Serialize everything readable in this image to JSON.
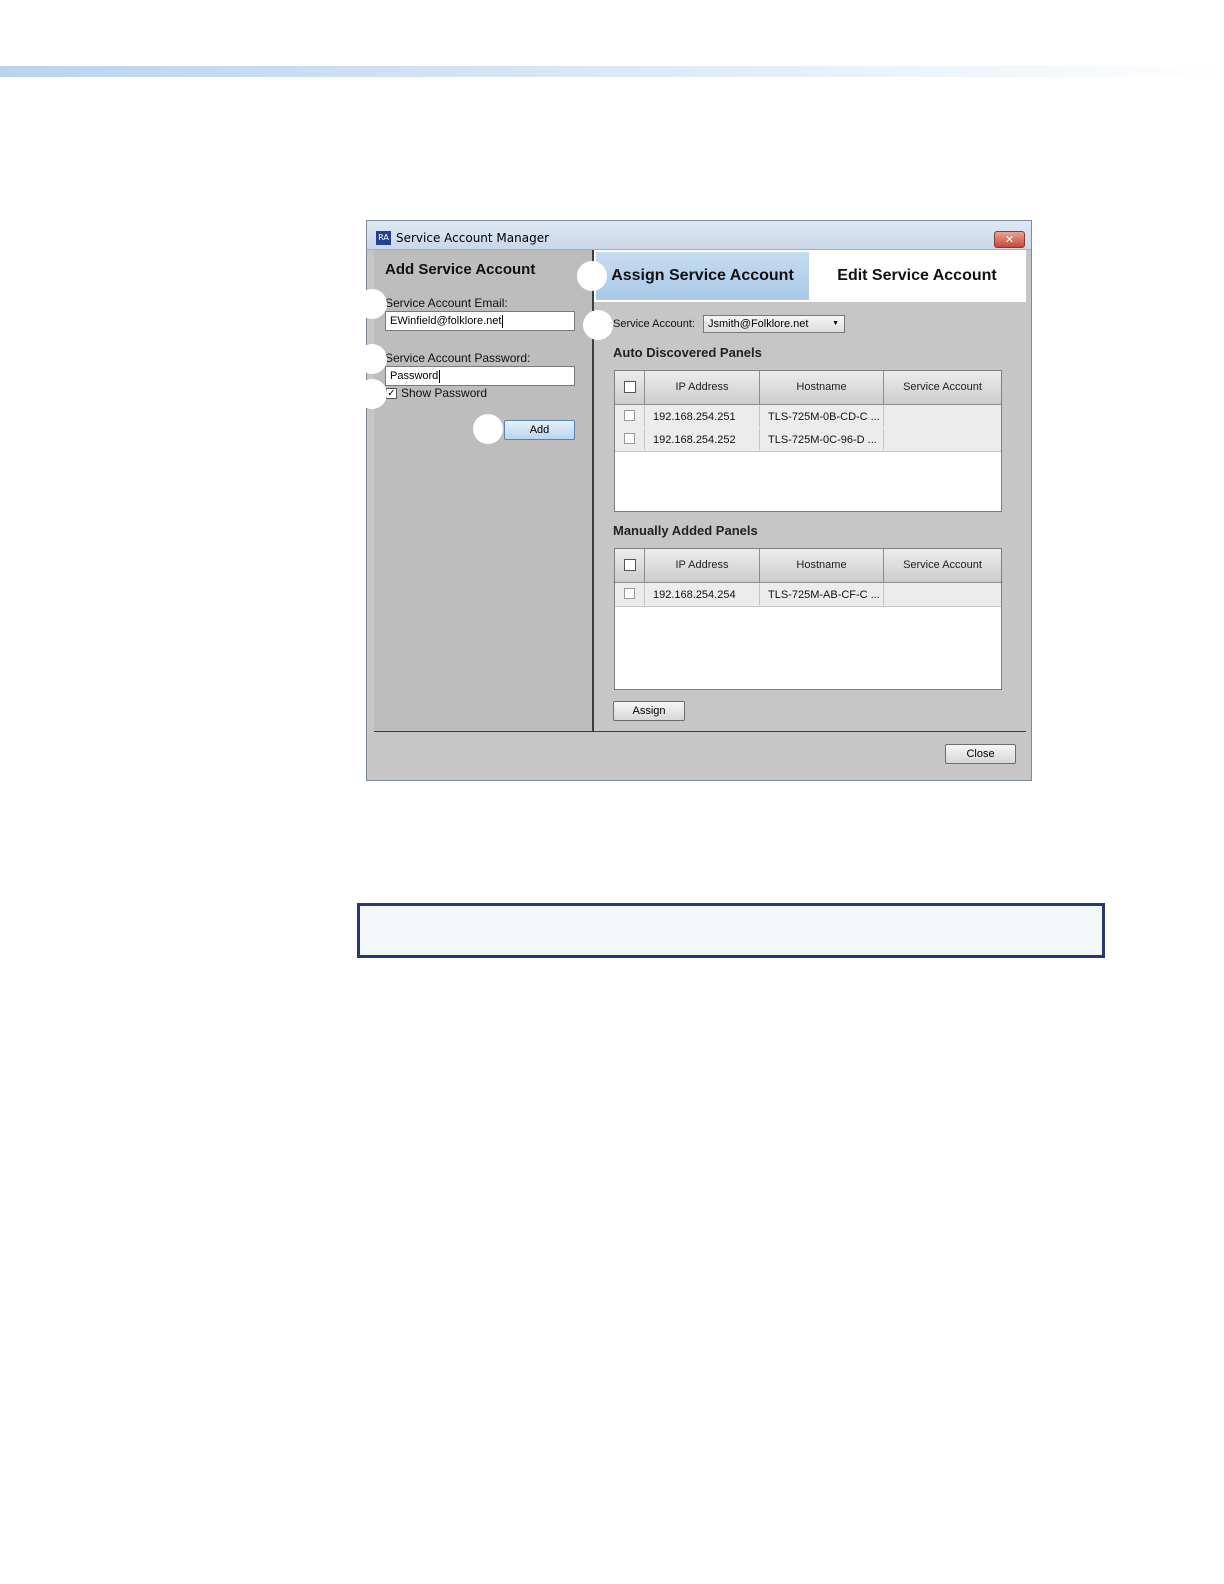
{
  "window": {
    "title": "Service Account Manager",
    "icon_text": "RA",
    "close_symbol": "✕"
  },
  "left": {
    "heading": "Add Service Account",
    "email_label": "Service Account Email:",
    "email_value": "EWinfield@folklore.net",
    "password_label": "Service Account Password:",
    "password_value": "Password",
    "show_password_label": "Show Password",
    "show_password_checked": "✓",
    "add_label": "Add"
  },
  "tabs": {
    "assign": "Assign Service Account",
    "edit": "Edit Service Account"
  },
  "assign": {
    "service_account_label": "Service Account:",
    "service_account_value": "Jsmith@Folklore.net",
    "dropdown_arrow": "▼",
    "auto_heading": "Auto Discovered Panels",
    "manual_heading": "Manually Added Panels",
    "columns": [
      "IP Address",
      "Hostname",
      "Service Account"
    ],
    "auto_rows": [
      {
        "ip": "192.168.254.251",
        "host": "TLS-725M-0B-CD-C ...",
        "account": ""
      },
      {
        "ip": "192.168.254.252",
        "host": "TLS-725M-0C-96-D ...",
        "account": ""
      }
    ],
    "manual_rows": [
      {
        "ip": "192.168.254.254",
        "host": "TLS-725M-AB-CF-C ...",
        "account": ""
      }
    ],
    "assign_label": "Assign"
  },
  "footer": {
    "close_label": "Close"
  },
  "colors": {
    "tab_active": "#b8d3ed",
    "note_border": "#283779"
  }
}
